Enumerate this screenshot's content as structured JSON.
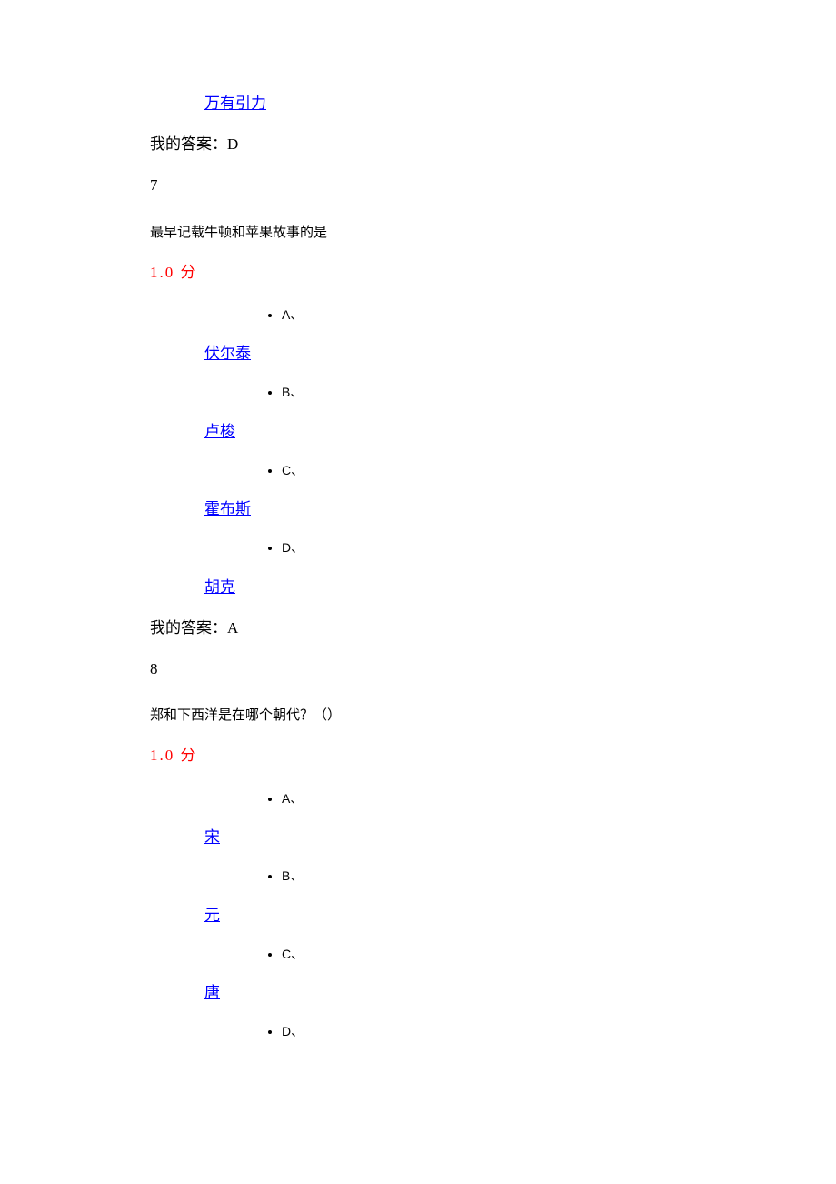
{
  "q6": {
    "option_d": "万有引力",
    "my_answer": "我的答案：D"
  },
  "q7": {
    "number": "7",
    "question": "最早记载牛顿和苹果故事的是",
    "score": "1.0  分",
    "options": {
      "a_label": "A、",
      "a_text": "伏尔泰",
      "b_label": "B、",
      "b_text": "卢梭",
      "c_label": "C、",
      "c_text": "霍布斯",
      "d_label": "D、",
      "d_text": "胡克"
    },
    "my_answer": "我的答案：A"
  },
  "q8": {
    "number": "8",
    "question": "郑和下西洋是在哪个朝代？（）",
    "score": "1.0  分",
    "options": {
      "a_label": "A、",
      "a_text": "宋",
      "b_label": "B、",
      "b_text": "元",
      "c_label": "C、",
      "c_text": "唐",
      "d_label": "D、"
    }
  }
}
